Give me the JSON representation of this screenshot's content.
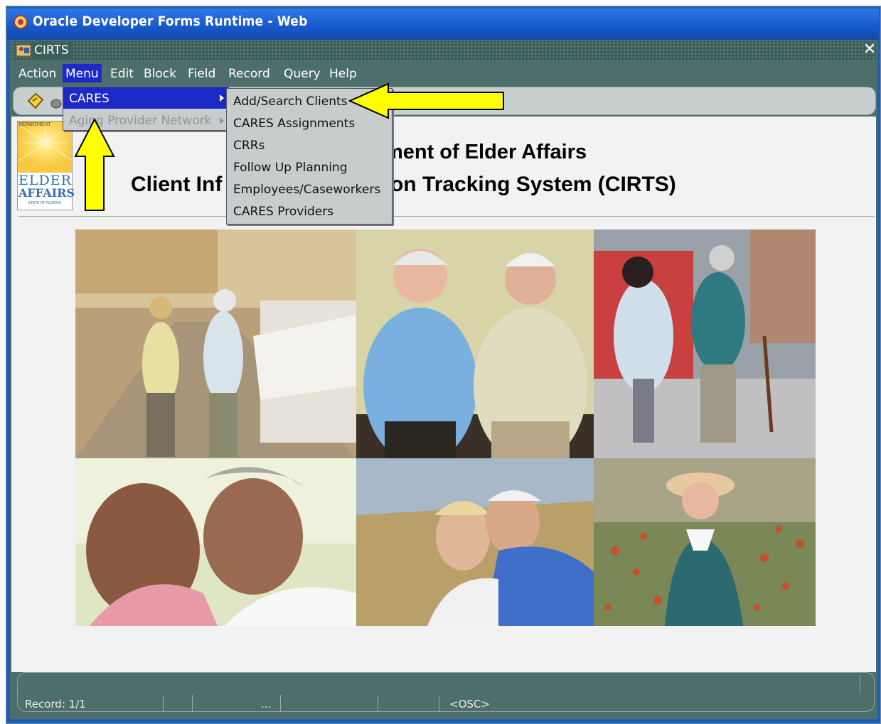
{
  "window": {
    "outer_title": "Oracle Developer Forms Runtime - Web",
    "inner_title": "CIRTS"
  },
  "menubar": {
    "items": [
      "Action",
      "Menu",
      "Edit",
      "Block",
      "Field",
      "Record",
      "Query",
      "Help"
    ],
    "active": "Menu"
  },
  "menu_dropdown": {
    "items": [
      {
        "label": "CARES",
        "highlighted": true,
        "enabled": true
      },
      {
        "label": "Aging Provider Network",
        "highlighted": false,
        "enabled": false
      }
    ]
  },
  "cares_submenu": {
    "items": [
      "Add/Search Clients",
      "CARES Assignments",
      "CRRs",
      "Follow Up Planning",
      "Employees/Caseworkers",
      "CARES Providers"
    ]
  },
  "header": {
    "line1": "rtment of Elder Affairs",
    "line2_left": "Client Inf",
    "line2_right": "egistration Tracking System (CIRTS)"
  },
  "logo": {
    "dept": "DEPARTMENT",
    "elder": "ELDER",
    "affairs": "AFFAIRS",
    "state": "STATE OF FLORIDA"
  },
  "status_bar": {
    "record": "Record: 1/1",
    "ellipsis": "...",
    "osc": "<OSC>"
  },
  "colors": {
    "menu_highlight": "#1c28c8",
    "callout_arrow": "#ffff00"
  }
}
